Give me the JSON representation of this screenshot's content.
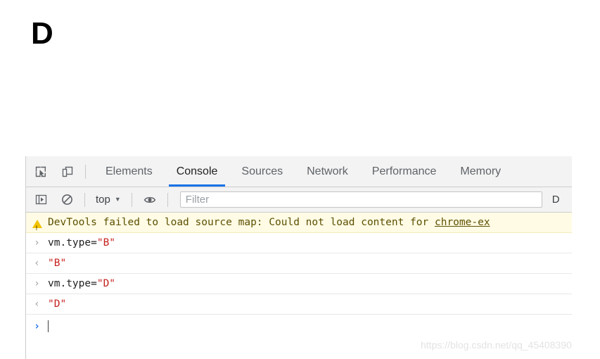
{
  "page": {
    "heading": "D"
  },
  "devtools": {
    "toolbar_icons": [
      {
        "name": "inspect-element-icon",
        "title": "Inspect element"
      },
      {
        "name": "device-toolbar-icon",
        "title": "Toggle device toolbar"
      }
    ],
    "tabs": [
      {
        "label": "Elements",
        "active": false
      },
      {
        "label": "Console",
        "active": true
      },
      {
        "label": "Sources",
        "active": false
      },
      {
        "label": "Network",
        "active": false
      },
      {
        "label": "Performance",
        "active": false
      },
      {
        "label": "Memory",
        "active": false
      }
    ],
    "filterbar": {
      "sidebar_toggle_icon": "console-sidebar-icon",
      "clear_console_icon": "clear-console-icon",
      "context_label": "top",
      "context_caret": "▼",
      "eye_icon": "live-expression-eye-icon",
      "filter_placeholder": "Filter",
      "filter_value": "",
      "levels_label": "D"
    },
    "console": {
      "entries": [
        {
          "kind": "warning",
          "gutter": "warn",
          "text": "DevTools failed to load source map: Could not load content for ",
          "link": "chrome-ex"
        },
        {
          "kind": "input",
          "gutter": "›",
          "code_plain": "vm.type=",
          "code_string": "\"B\""
        },
        {
          "kind": "output",
          "gutter": "‹",
          "code_string": "\"B\""
        },
        {
          "kind": "input",
          "gutter": "›",
          "code_plain": "vm.type=",
          "code_string": "\"D\""
        },
        {
          "kind": "output",
          "gutter": "‹",
          "code_string": "\"D\""
        }
      ],
      "prompt": {
        "chevron": "›",
        "value": ""
      }
    }
  },
  "watermark": {
    "text": "https://blog.csdn.net/qq_45408390"
  },
  "colors": {
    "accent": "#1a73e8",
    "warning_bg": "#fffbe5",
    "warning_text": "#5c5000",
    "string_literal": "#c5221f",
    "toolbar_bg": "#f3f3f3"
  }
}
